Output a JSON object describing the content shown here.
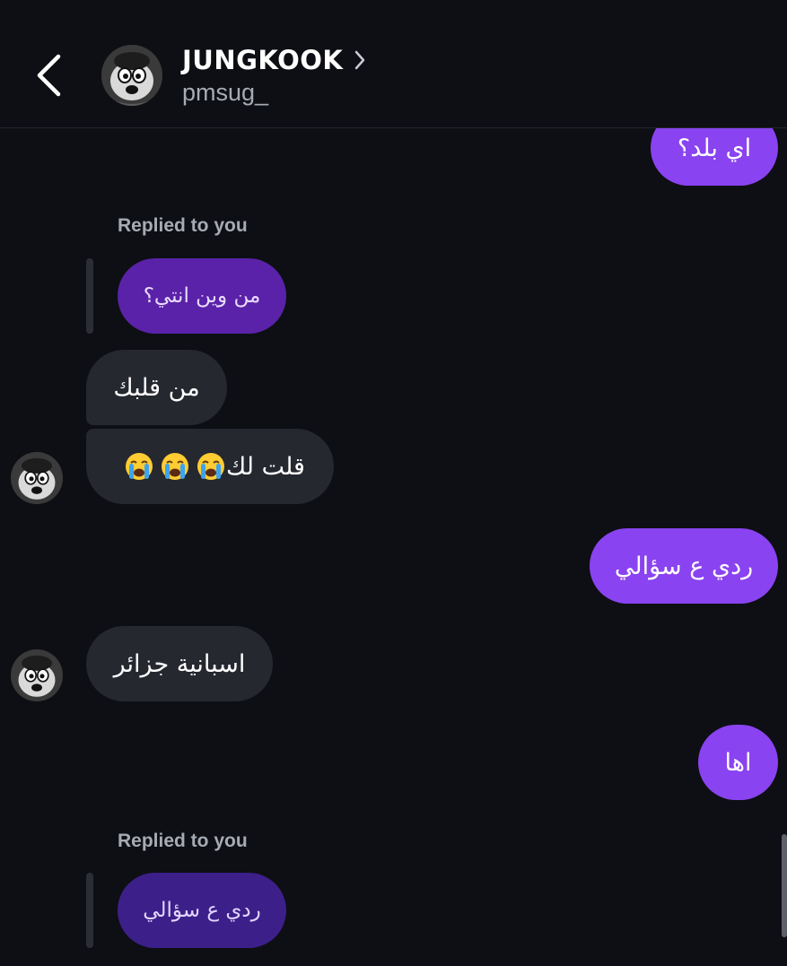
{
  "header": {
    "name": "JUNGKOOK",
    "username": "pmsug_"
  },
  "messages": {
    "m1": "اي بلد؟",
    "replied_label_1": "Replied to you",
    "quote_1": "من وين انتي؟",
    "m2": "من قلبك",
    "m3": "قلت لك",
    "m3_emoji": "😭😭😭",
    "m4": "ردي ع سؤالي",
    "m5": "اسبانية جزائر",
    "m6": "اها",
    "replied_label_2": "Replied to you",
    "quote_2": "ردي ع سؤالي"
  },
  "colors": {
    "background": "#0d0f14",
    "sent_bubble": "#8a43f0",
    "received_bubble": "#262830",
    "quoted_bubble": "#5a22a8"
  },
  "icons": {
    "back": "chevron-left-icon",
    "profile": "chevron-right-icon",
    "emoji": "loudly-crying-face-emoji"
  }
}
